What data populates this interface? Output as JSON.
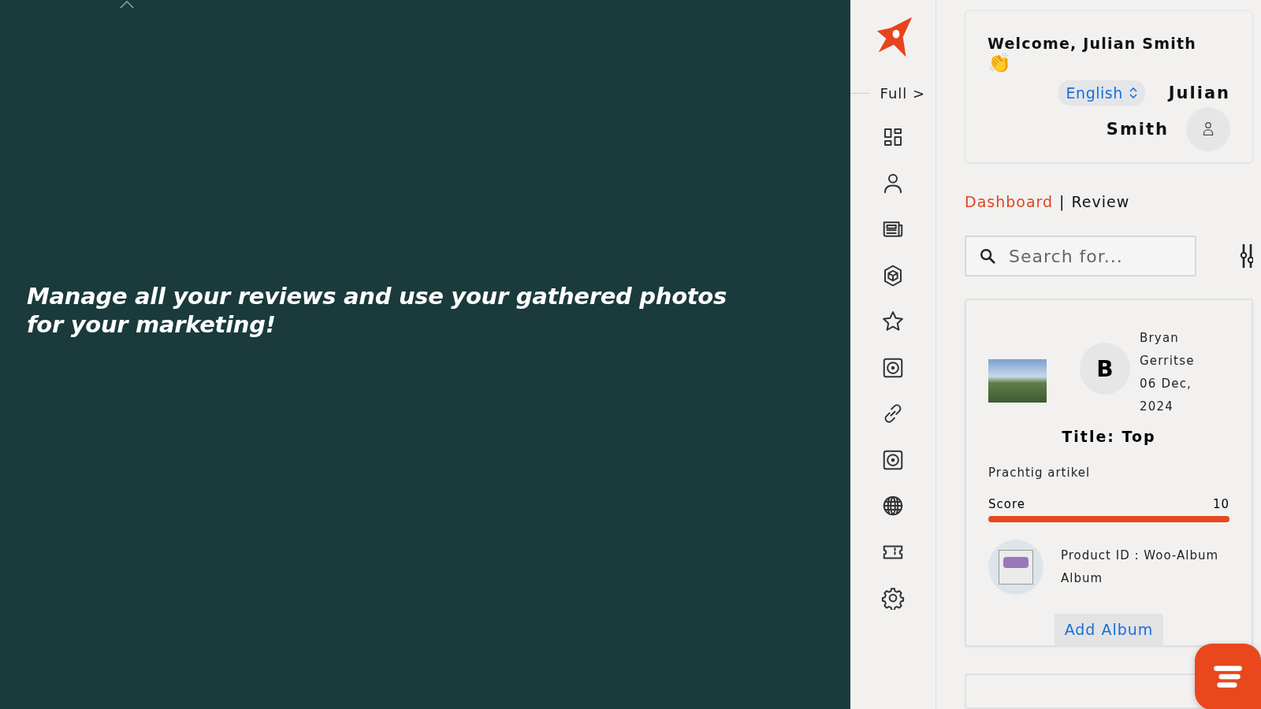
{
  "hero": {
    "text": "Manage all your reviews and use your gathered photos for your marketing!"
  },
  "sidebar": {
    "toggle": "Full >"
  },
  "header": {
    "welcome": "Welcome, Julian Smith",
    "emoji": "👏",
    "language": "English",
    "user_first": "Julian",
    "user_last": "Smith"
  },
  "breadcrumb": [
    {
      "label": "Dashboard",
      "kind": "link"
    },
    {
      "label": "|",
      "kind": "separator"
    },
    {
      "label": "Review",
      "kind": "current"
    }
  ],
  "search": {
    "placeholder": "Search for..."
  },
  "review": {
    "initial": "B",
    "author_first": "Bryan",
    "author_last": "Gerritse",
    "date_day": "06 Dec,",
    "date_year": "2024",
    "title": "Title: Top",
    "body": "Prachtig artikel",
    "score_label": "Score",
    "score_value": "10",
    "level": 1,
    "product_line1": "Product ID : Woo-Album",
    "product_line2": "Album",
    "button": "Add Album"
  }
}
